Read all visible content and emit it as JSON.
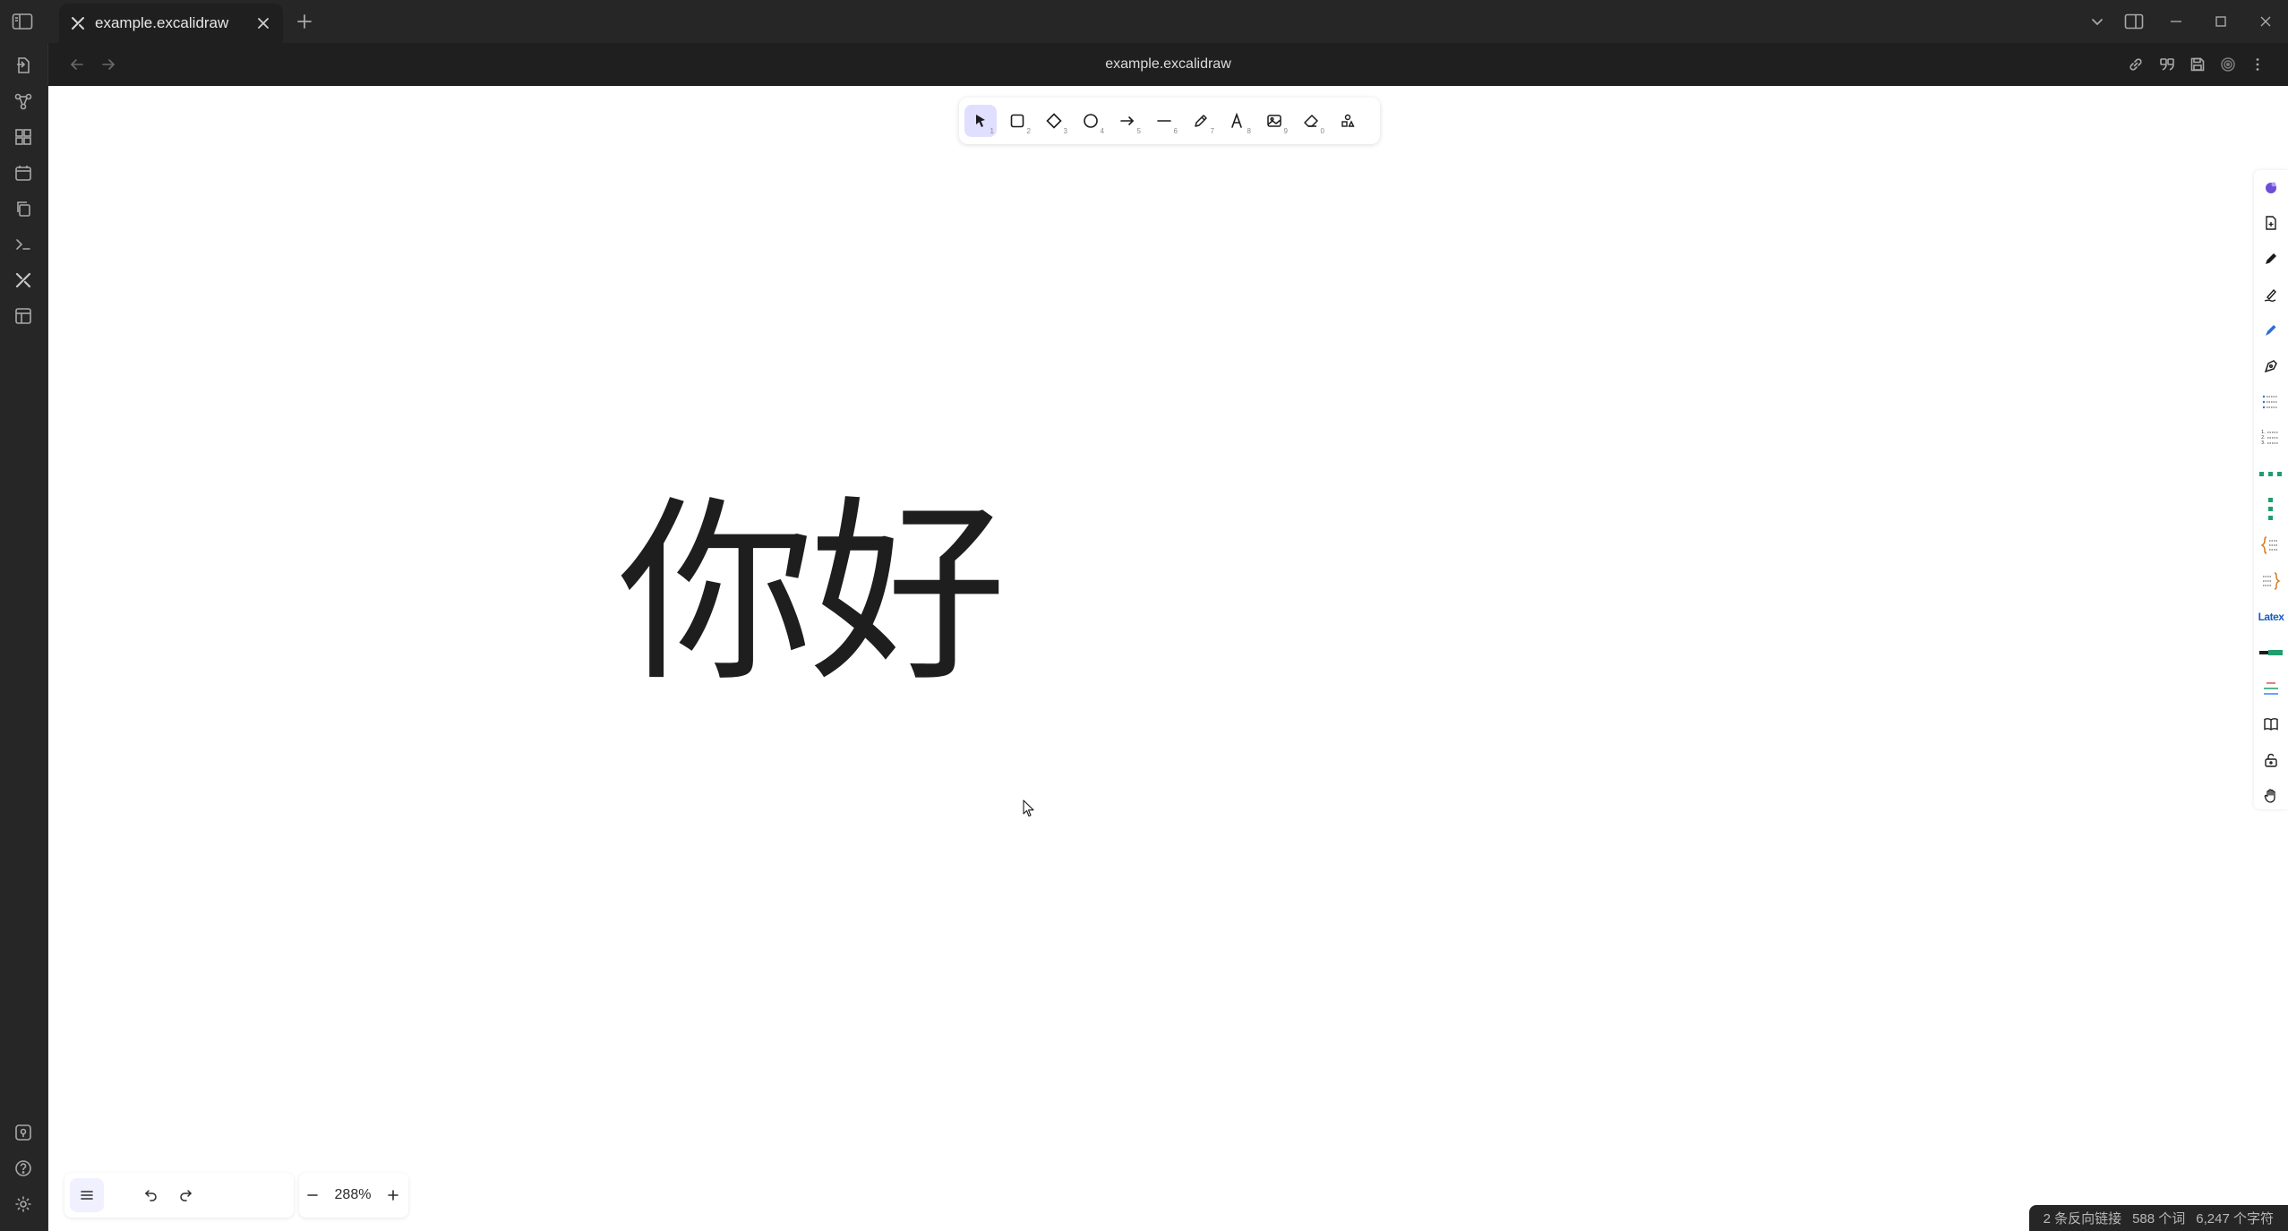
{
  "app": {
    "tab_title": "example.excalidraw",
    "view_title": "example.excalidraw"
  },
  "canvas": {
    "text_element": "你好",
    "zoom": "288%"
  },
  "toolbar": {
    "tools": [
      {
        "name": "selection",
        "key": "1",
        "active": true
      },
      {
        "name": "rectangle",
        "key": "2"
      },
      {
        "name": "diamond",
        "key": "3"
      },
      {
        "name": "ellipse",
        "key": "4"
      },
      {
        "name": "arrow",
        "key": "5"
      },
      {
        "name": "line",
        "key": "6"
      },
      {
        "name": "draw",
        "key": "7"
      },
      {
        "name": "text",
        "key": "8"
      },
      {
        "name": "image",
        "key": "9"
      },
      {
        "name": "eraser",
        "key": "0"
      },
      {
        "name": "extra-tools",
        "key": ""
      }
    ]
  },
  "sidepanel": {
    "latex_label": "Latex"
  },
  "statusbar": {
    "backlinks": "2 条反向链接",
    "words": "588 个词",
    "chars": "6,247 个字符"
  },
  "colors": {
    "chrome_dark": "#262626",
    "header_dark": "#1f1f1f",
    "active_tool": "#e0dfff",
    "canvas_bg": "#ffffff",
    "ink": "#1e1e1e"
  }
}
